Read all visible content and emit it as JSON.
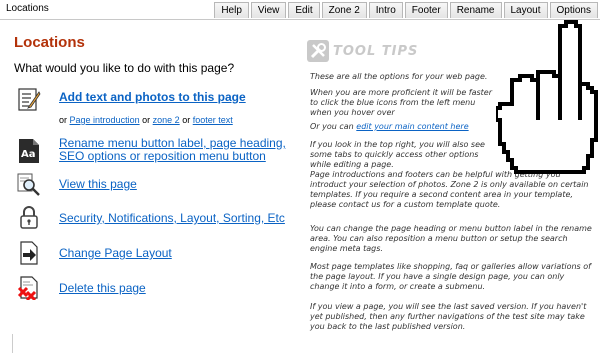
{
  "window": {
    "title": "Locations"
  },
  "tabs": [
    "Help",
    "View",
    "Edit",
    "Zone 2",
    "Intro",
    "Footer",
    "Rename",
    "Layout",
    "Options"
  ],
  "main": {
    "heading": "Locations",
    "question": "What would you like to do with this page?",
    "options": [
      {
        "label": "Add text and photos to this page",
        "icon": "edit-text-icon"
      },
      {
        "label": "Rename menu button label, page heading, SEO options or reposition menu button",
        "icon": "font-aa-icon"
      },
      {
        "label": "View this page",
        "icon": "magnifier-icon"
      },
      {
        "label": "Security, Notifications, Layout, Sorting, Etc",
        "icon": "lock-icon"
      },
      {
        "label": "Change Page Layout",
        "icon": "layout-arrow-icon"
      },
      {
        "label": "Delete this page",
        "icon": "delete-page-icon"
      }
    ],
    "sublinks": {
      "prefix": "or",
      "link1": "Page introduction",
      "sep1": "or",
      "link2": "zone 2",
      "sep2": "or",
      "link3": "footer text"
    }
  },
  "tool_tips": {
    "title": "TOOL TIPS",
    "p1": "These are all the options for your web page.",
    "p2": "When you are more proficient it will be faster to click the blue icons from the left menu when you hover over",
    "p3_prefix": "Or you can",
    "p3_link": "edit your main content here",
    "p4": "If you look in the top right, you will also see some tabs to quickly access other options while editing a page.",
    "p5": "Page introductions and footers can be helpful with getting you introduct your selection of photos. Zone 2 is only available on certain templates. If you require a second content area in your template, please contact us for a custom template quote.",
    "p6": "You can change the page heading or menu button label in the rename area. You can also reposition a menu button or setup the search engine meta tags.",
    "p7": "Most page templates like shopping, faq or galleries allow variations of the page layout. If you have a single design page, you can only change it into a form, or create a submenu.",
    "p8": "If you view a page, you will see the last saved version. If you haven't yet published, then any further navigations of the test site may take you back to the last published version."
  },
  "colors": {
    "heading": "#b3320a",
    "link": "#0b63c4"
  }
}
